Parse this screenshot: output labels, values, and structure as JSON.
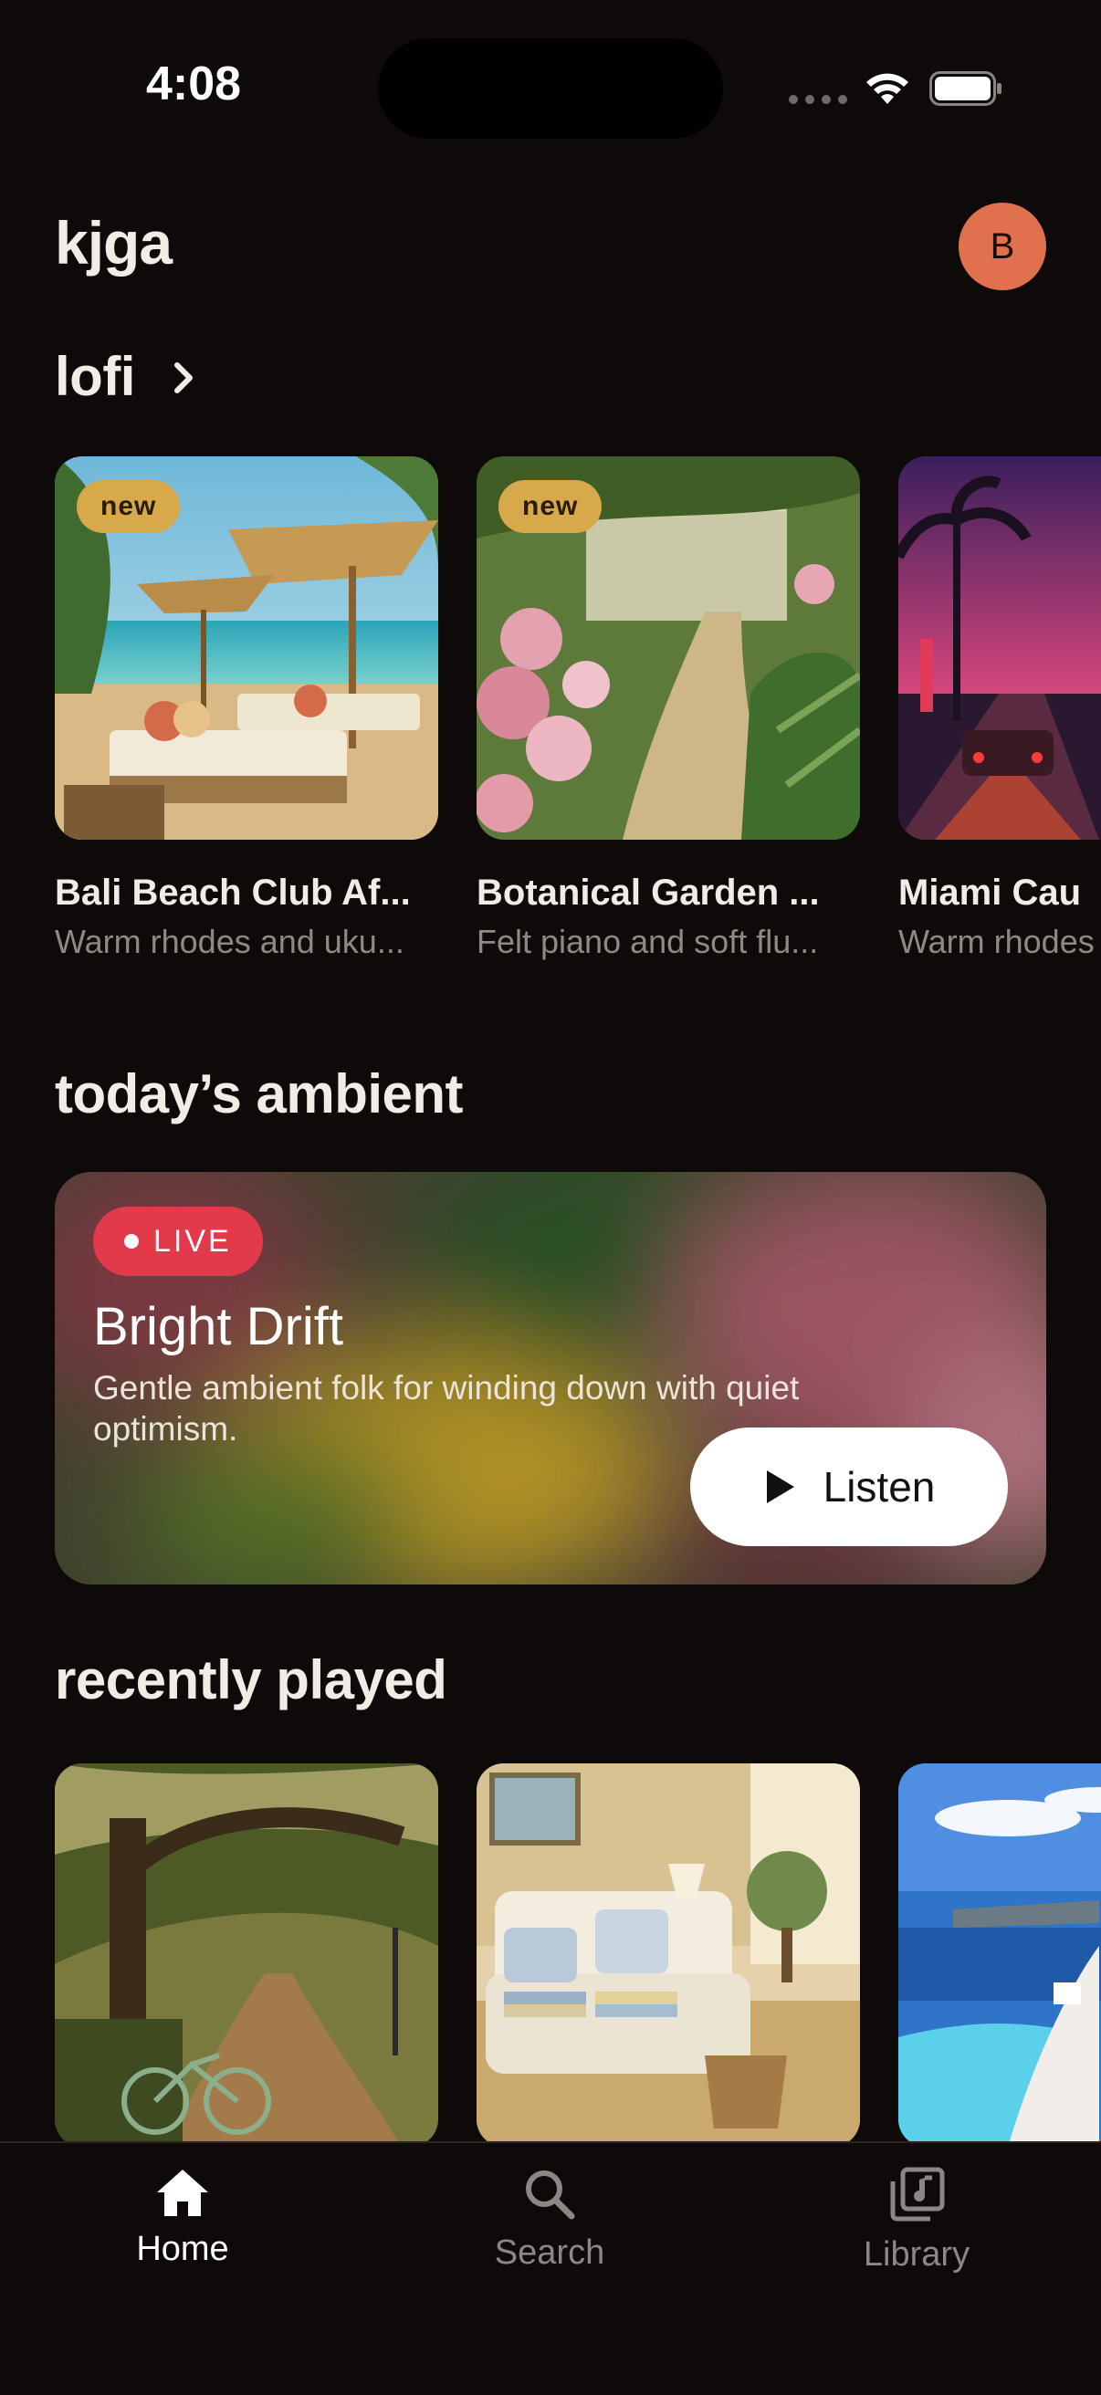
{
  "status": {
    "time": "4:08"
  },
  "header": {
    "title": "kjga",
    "avatar_initial": "B"
  },
  "lofi": {
    "title": "lofi",
    "cards": [
      {
        "badge": "new",
        "title": "Bali Beach Club Af...",
        "subtitle": "Warm rhodes and uku..."
      },
      {
        "badge": "new",
        "title": "Botanical Garden ...",
        "subtitle": "Felt piano and soft flu..."
      },
      {
        "title": "Miami Cau",
        "subtitle": "Warm rhodes"
      }
    ]
  },
  "ambient": {
    "title": "today’s ambient",
    "live_label": "LIVE",
    "card_title": "Bright Drift",
    "card_description": "Gentle ambient folk for winding down with quiet optimism.",
    "listen_label": "Listen"
  },
  "recent": {
    "title": "recently played"
  },
  "tabs": [
    {
      "label": "Home",
      "icon": "home-icon",
      "active": true
    },
    {
      "label": "Search",
      "icon": "search-icon",
      "active": false
    },
    {
      "label": "Library",
      "icon": "library-icon",
      "active": false
    }
  ],
  "colors": {
    "background": "#0e0a0a",
    "badge": "#d7a94b",
    "live": "#e23a4a",
    "avatar": "#e0704e"
  }
}
